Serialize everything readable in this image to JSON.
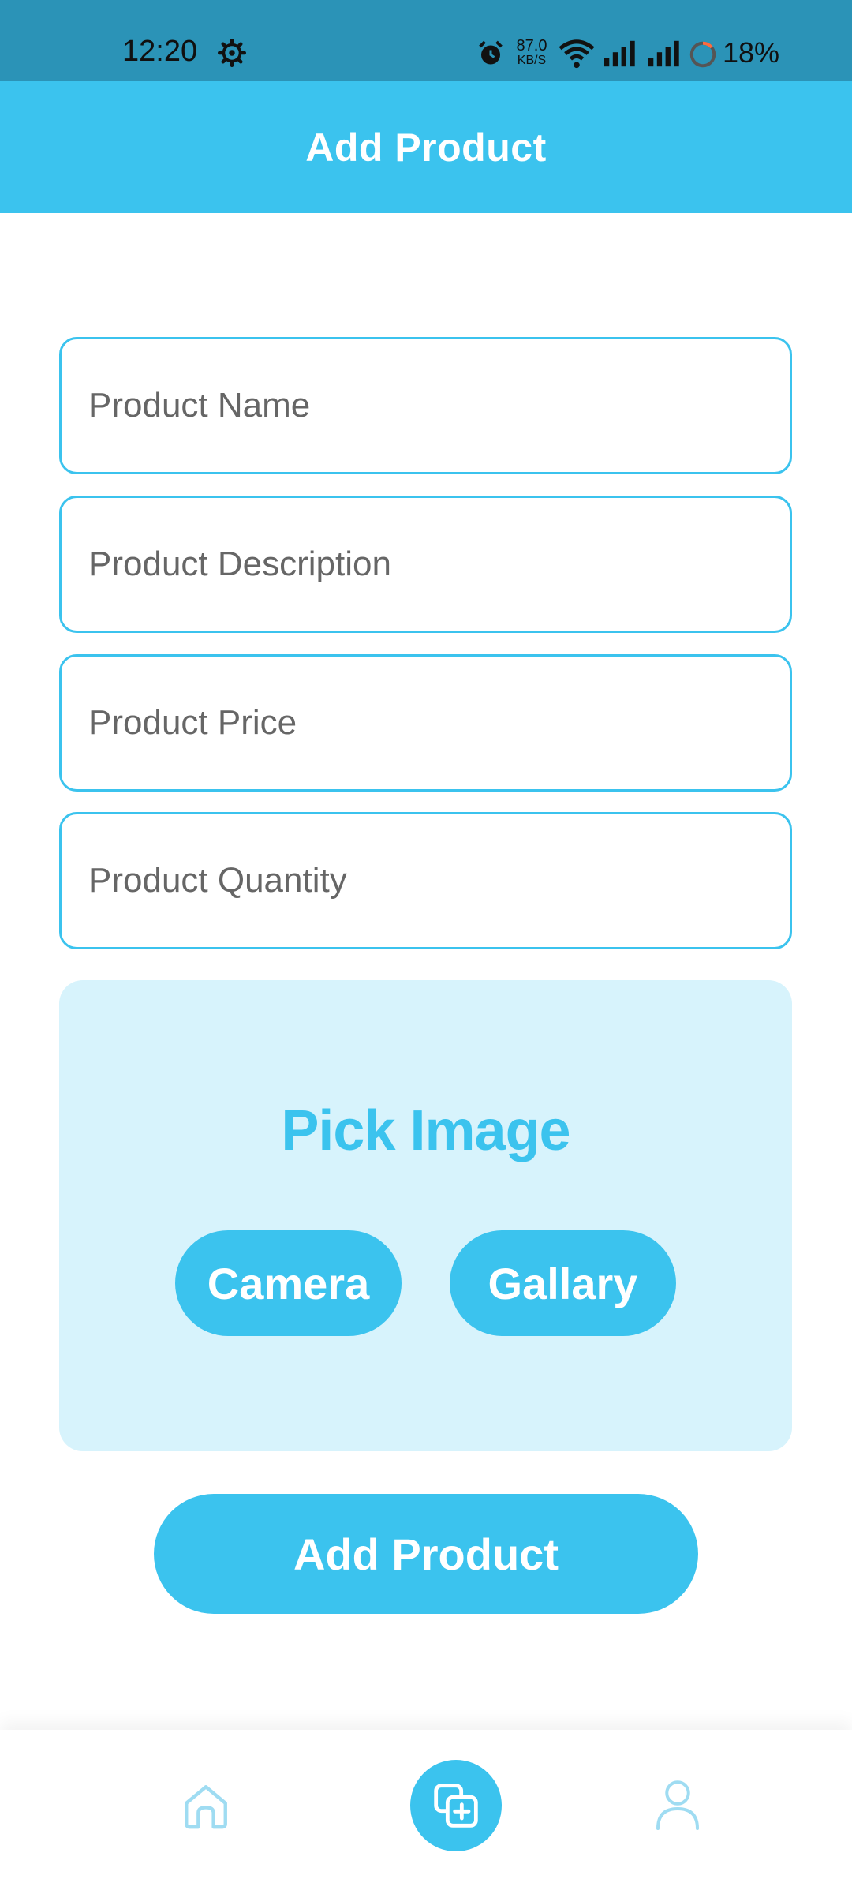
{
  "status_bar": {
    "time": "12:20",
    "net_speed_value": "87.0",
    "net_speed_unit": "KB/S",
    "battery_percent": "18%"
  },
  "header": {
    "title": "Add Product"
  },
  "form": {
    "product_name_placeholder": "Product Name",
    "product_description_placeholder": "Product Description",
    "product_price_placeholder": "Product Price",
    "product_quantity_placeholder": "Product Quantity"
  },
  "image_picker": {
    "title": "Pick Image",
    "camera_label": "Camera",
    "gallery_label": "Gallary"
  },
  "submit_label": "Add Product",
  "bottom_nav": {
    "items": [
      {
        "icon": "home-icon",
        "active": false
      },
      {
        "icon": "add-product-icon",
        "active": true
      },
      {
        "icon": "profile-icon",
        "active": false
      }
    ]
  },
  "colors": {
    "status_bar": "#2b93b7",
    "accent": "#3bc3ee",
    "card_background": "#d7f3fc",
    "nav_icon_inactive": "#9fdcf2"
  }
}
